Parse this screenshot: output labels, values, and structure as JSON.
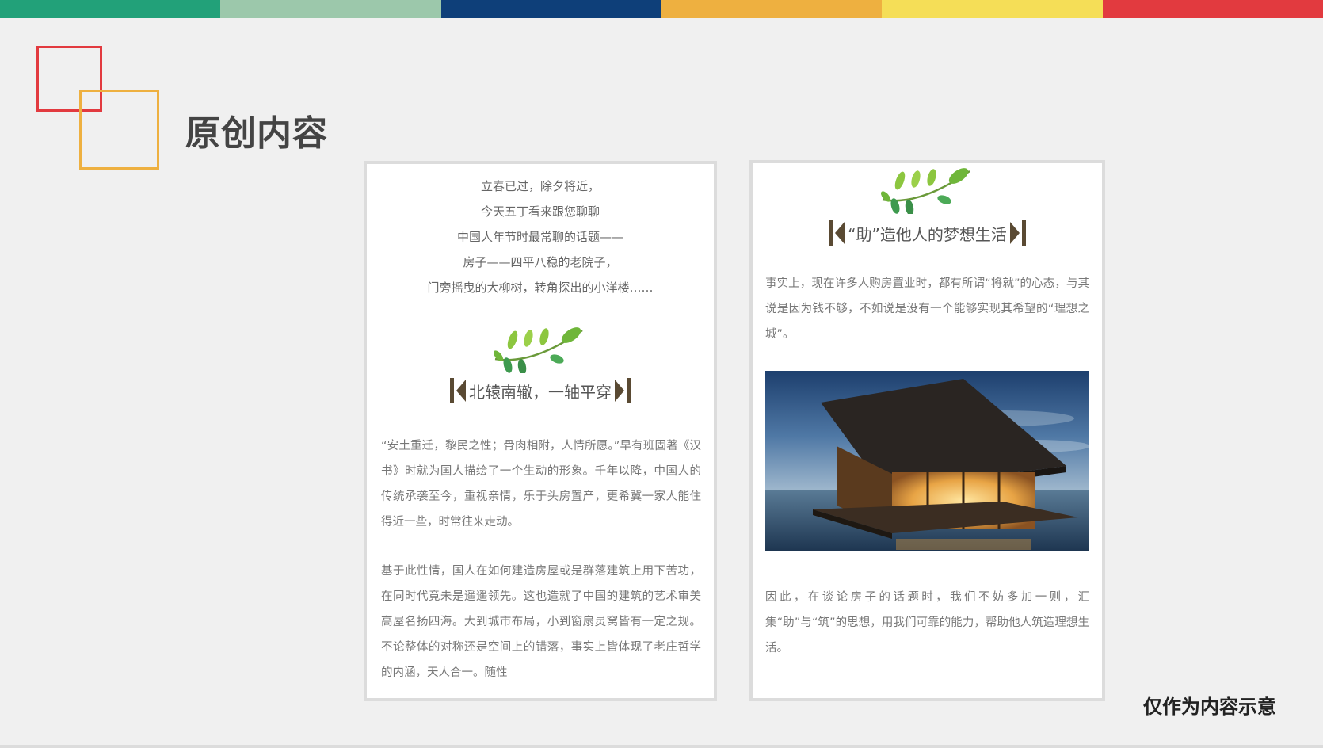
{
  "page": {
    "title": "原创内容",
    "note": "仅作为内容示意"
  },
  "topbar_colors": [
    "#22a179",
    "#9cc8ab",
    "#0e3f79",
    "#eeb040",
    "#f5de57",
    "#e23a3f"
  ],
  "decor": {
    "square_red": "#e23a3f",
    "square_orange": "#eeb040"
  },
  "left_card": {
    "poem": [
      "立春已过，除夕将近，",
      "今天五丁看来跟您聊聊",
      "中国人年节时最常聊的话题——",
      "房子——四平八稳的老院子，",
      "门旁摇曳的大柳树，转角探出的小洋楼……"
    ],
    "leaf_icon": "leaf-branch-icon",
    "heading": "北辕南辙，一轴平穿",
    "paragraphs": [
      "“安土重迁，黎民之性；骨肉相附，人情所愿。”早有班固著《汉书》时就为国人描绘了一个生动的形象。千年以降，中国人的传统承袭至今，重视亲情，乐于头房置产，更希冀一家人能住得近一些，时常往来走动。",
      "基于此性情，国人在如何建造房屋或是群落建筑上用下苦功，在同时代竟未是遥遥领先。这也造就了中国的建筑的艺术审美高屋名扬四海。大到城市布局，小到窗扇灵窝皆有一定之规。不论整体的对称还是空间上的错落，事实上皆体现了老庄哲学的内涵，天人合一。随性"
    ]
  },
  "right_card": {
    "leaf_icon": "leaf-branch-icon",
    "heading": "“助”造他人的梦想生活",
    "paragraph_top": "事实上，现在许多人购房置业时，都有所谓“将就”的心态，与其说是因为钱不够，不如说是没有一个能够实现其希望的“理想之城”。",
    "photo_icon": "glass-house-photo",
    "paragraph_bottom": "因此，在谈论房子的话题时，我们不妨多加一则，汇集“助”与“筑”的思想，用我们可靠的能力，帮助他人筑造理想生活。"
  }
}
